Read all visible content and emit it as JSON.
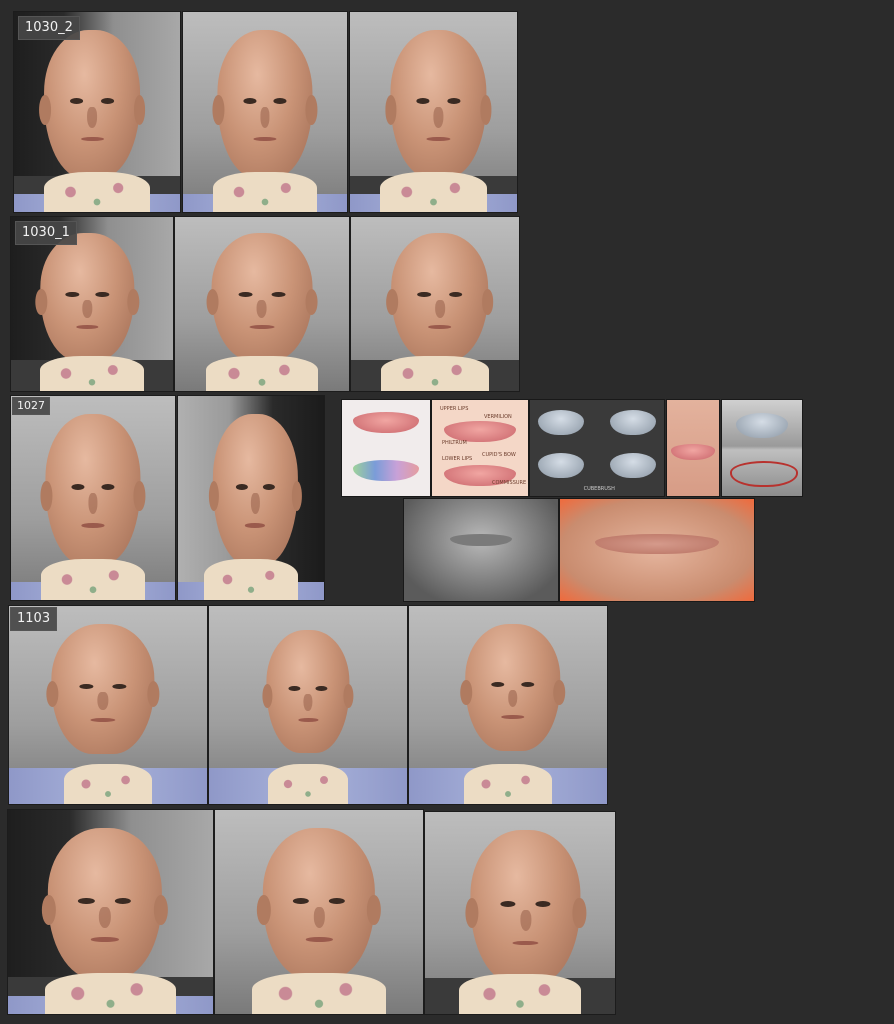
{
  "groups": {
    "g1": {
      "label": "1030_2"
    },
    "g2": {
      "label": "1030_1"
    },
    "g3": {
      "label": "1027"
    },
    "g4": {
      "label": "1103"
    }
  },
  "reference": {
    "lip_chart_labels": [
      "UPPER LIPS",
      "VERMILION",
      "PHILTRUM",
      "CUPID'S BOW",
      "LOWER LIPS",
      "COMMISSURE"
    ],
    "watermark": "CUBEBRUSH"
  },
  "colors": {
    "canvas": "#2b2b2b",
    "tag_bg": "#464646",
    "tag_text": "#f2f2f2"
  }
}
